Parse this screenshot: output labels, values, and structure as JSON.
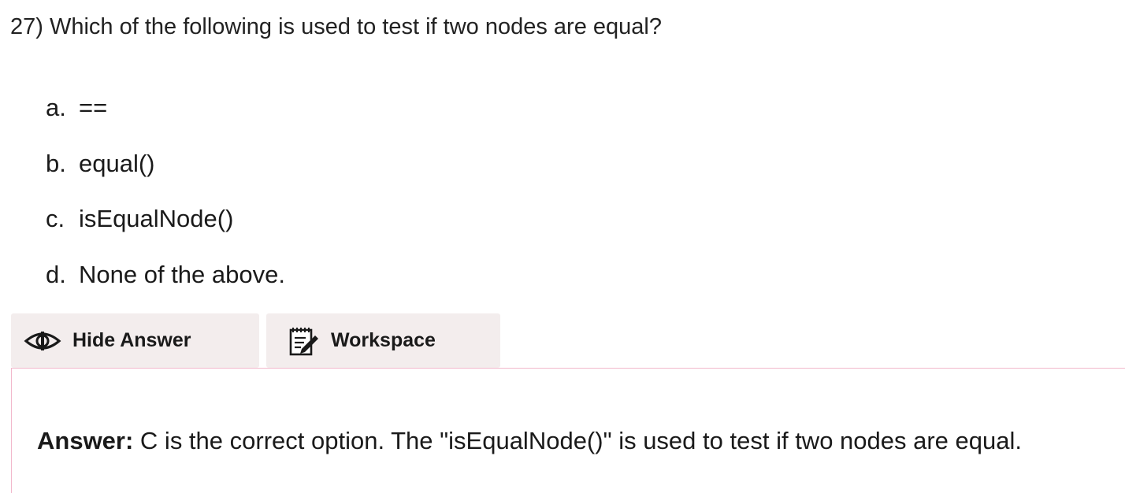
{
  "question": {
    "text": "27) Which of the following is used to test if two nodes are equal?"
  },
  "options": [
    {
      "letter": "a.",
      "text": "=="
    },
    {
      "letter": "b.",
      "text": "equal()"
    },
    {
      "letter": "c.",
      "text": "isEqualNode()"
    },
    {
      "letter": "d.",
      "text": "None of the above."
    }
  ],
  "buttons": {
    "hide_answer": {
      "label": "Hide Answer",
      "icon": "eye-icon"
    },
    "workspace": {
      "label": "Workspace",
      "icon": "notepad-edit-icon"
    }
  },
  "answer": {
    "label": "Answer:",
    "text": " C is the correct option. The \"isEqualNode()\" is used to test if two nodes are equal."
  },
  "colors": {
    "button_bg": "#f3eded",
    "answer_border": "#f2b8cc"
  }
}
